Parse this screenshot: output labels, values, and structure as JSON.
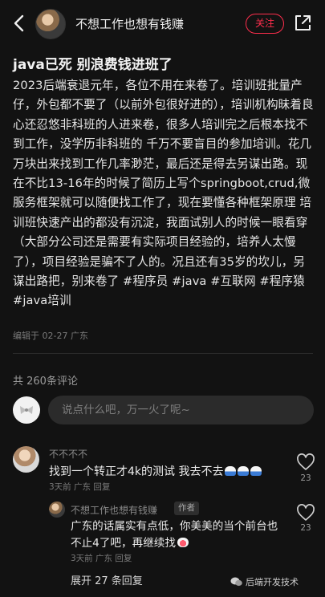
{
  "header": {
    "author": "不想工作也想有钱赚",
    "follow_label": "关注"
  },
  "post": {
    "title": "java已死 别浪费钱进班了",
    "body": "2023后端衰退元年，各位不用在来卷了。培训班批量产仔，外包都不要了（以前外包很好进的），培训机构昧着良心还忍悠非科班的人进来卷，很多人培训完之后根本找不到工作，没学历非科班的 千万不要盲目的参加培训。花几万块出来找到工作几率渺茫，最后还是得去另谋出路。现在不比13-16年的时候了简历上写个springboot,crud,微服务框架就可以随便找工作了，现在要懂各种框架原理 培训班快速产出的都没有沉淀，我面试别人的时候一眼看穿（大部分公司还是需要有实际项目经验的，培养人太慢了），项目经验是骗不了人的。况且还有35岁的坎儿，另谋出路把，别来卷了",
    "tags": [
      "#程序员",
      "#java",
      "#互联网",
      "#程序猿",
      "#java培训"
    ],
    "meta": "编辑于 02-27 广东"
  },
  "comments_section": {
    "count_label": "共 260条评论",
    "input_placeholder": "说点什么吧，万一火了呢~"
  },
  "comments": [
    {
      "name": "不不不不",
      "text": "找到一个转正才4k的测试 我去不去",
      "meta": "3天前  广东  回复",
      "likes": "23"
    }
  ],
  "reply": {
    "name": "不想工作也想有钱赚",
    "badge": "作者",
    "text": "广东的话属实有点低，你美美的当个前台也不止4了吧，再继续找",
    "meta": "3天前  广东  回复",
    "likes": "23",
    "expand_label": "展开 27 条回复"
  },
  "watermark": "后端开发技术",
  "colors": {
    "background": "#121212",
    "accent": "#ff2e4d"
  }
}
